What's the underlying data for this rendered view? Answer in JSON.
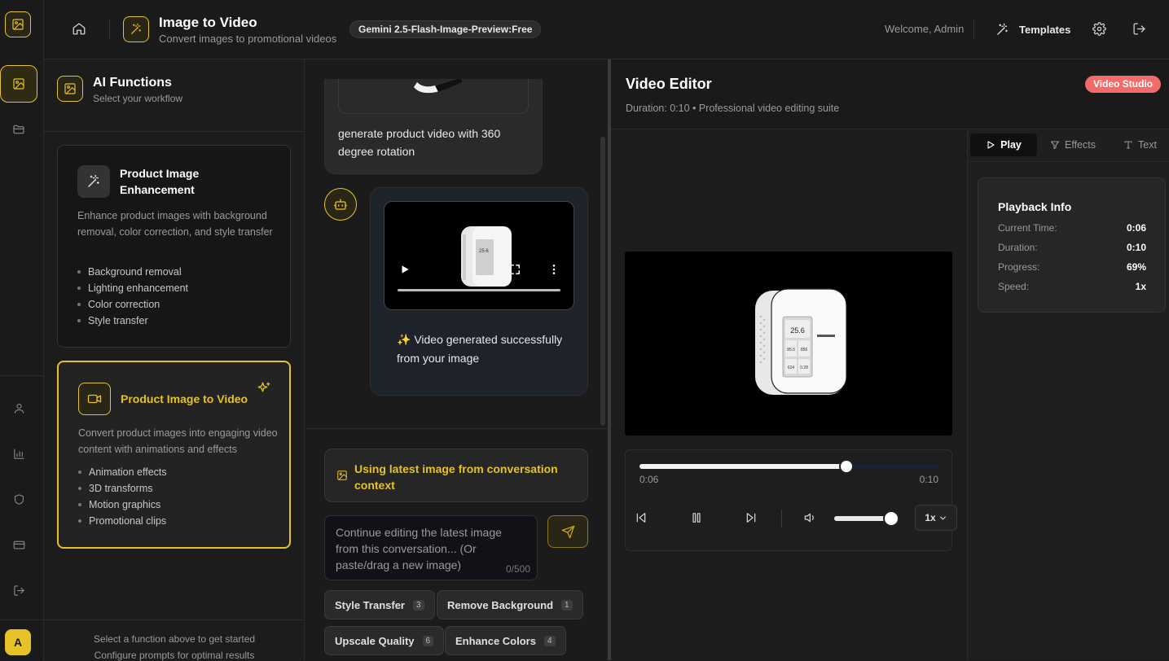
{
  "header": {
    "title": "Image to Video",
    "subtitle": "Convert images to promotional videos",
    "model_badge": "Gemini 2.5-Flash-Image-Preview:Free",
    "welcome": "Welcome, Admin",
    "templates_label": "Templates"
  },
  "rail": {
    "avatar_letter": "A"
  },
  "left_panel": {
    "title": "AI Functions",
    "subtitle": "Select your workflow",
    "cards": [
      {
        "title": "Product Image Enhancement",
        "description": "Enhance product images with background removal, color correction, and style transfer",
        "features": [
          "Background removal",
          "Lighting enhancement",
          "Color correction",
          "Style transfer"
        ]
      },
      {
        "title": "Product Image to Video",
        "description": "Convert product images into engaging video content with animations and effects",
        "features": [
          "Animation effects",
          "3D transforms",
          "Motion graphics",
          "Promotional clips"
        ]
      }
    ],
    "footer_line1": "Select a function above to get started",
    "footer_line2": "Configure prompts for optimal results"
  },
  "chat": {
    "user_message": "generate product video with 360 degree rotation",
    "bot_message": "✨ Video generated successfully from your image",
    "context_notice": "Using latest image from conversation context",
    "prompt_placeholder": "Continue editing the latest image from this conversation... (Or paste/drag a new image)",
    "char_count": "0/500",
    "quick_actions": [
      {
        "label": "Style Transfer",
        "count": "3"
      },
      {
        "label": "Remove Background",
        "count": "1"
      },
      {
        "label": "Upscale Quality",
        "count": "6"
      },
      {
        "label": "Enhance Colors",
        "count": "4"
      }
    ]
  },
  "editor": {
    "title": "Video Editor",
    "subtitle": "Duration: 0:10 • Professional video editing suite",
    "badge": "Video Studio",
    "current_time": "0:06",
    "total_time": "0:10",
    "progress_fraction": 0.69,
    "volume_fraction": 0.9,
    "speed": "1x",
    "device_readings": [
      "25.6",
      "85.0",
      "856",
      "624",
      "0.28"
    ],
    "tabs": [
      "Play",
      "Effects",
      "Text"
    ],
    "playback_info": {
      "title": "Playback Info",
      "rows": [
        {
          "label": "Current Time:",
          "value": "0:06"
        },
        {
          "label": "Duration:",
          "value": "0:10"
        },
        {
          "label": "Progress:",
          "value": "69%"
        },
        {
          "label": "Speed:",
          "value": "1x"
        }
      ]
    }
  },
  "colors": {
    "accent": "#e6c229",
    "badge": "#f26b6b",
    "panel": "#1b1b1b"
  }
}
